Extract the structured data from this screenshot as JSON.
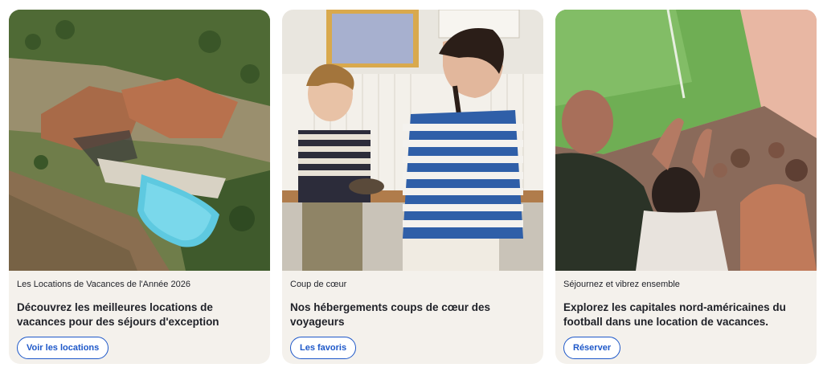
{
  "cards": [
    {
      "eyebrow": "Les Locations de Vacances de l'Année 2026",
      "title": "Découvrez les meilleures locations de vacances pour des séjours d'exception",
      "cta": "Voir les locations"
    },
    {
      "eyebrow": "Coup de cœur",
      "title": "Nos hébergements coups de cœur des voyageurs",
      "cta": "Les favoris"
    },
    {
      "eyebrow": "Séjournez et vibrez ensemble",
      "title": "Explorez les capitales nord-américaines du football dans une location de vacances.",
      "cta": "Réserver"
    }
  ],
  "colors": {
    "card_background": "#f4f1ec",
    "text": "#1f2128",
    "accent": "#1e58c9"
  }
}
